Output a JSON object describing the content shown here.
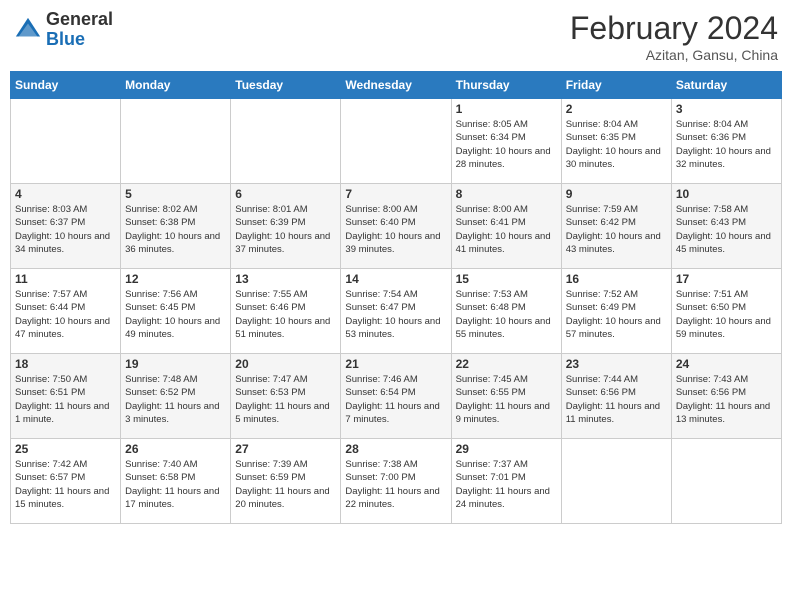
{
  "header": {
    "logo_general": "General",
    "logo_blue": "Blue",
    "month_title": "February 2024",
    "location": "Azitan, Gansu, China"
  },
  "days_of_week": [
    "Sunday",
    "Monday",
    "Tuesday",
    "Wednesday",
    "Thursday",
    "Friday",
    "Saturday"
  ],
  "weeks": [
    [
      {
        "day": "",
        "info": ""
      },
      {
        "day": "",
        "info": ""
      },
      {
        "day": "",
        "info": ""
      },
      {
        "day": "",
        "info": ""
      },
      {
        "day": "1",
        "info": "Sunrise: 8:05 AM\nSunset: 6:34 PM\nDaylight: 10 hours and 28 minutes."
      },
      {
        "day": "2",
        "info": "Sunrise: 8:04 AM\nSunset: 6:35 PM\nDaylight: 10 hours and 30 minutes."
      },
      {
        "day": "3",
        "info": "Sunrise: 8:04 AM\nSunset: 6:36 PM\nDaylight: 10 hours and 32 minutes."
      }
    ],
    [
      {
        "day": "4",
        "info": "Sunrise: 8:03 AM\nSunset: 6:37 PM\nDaylight: 10 hours and 34 minutes."
      },
      {
        "day": "5",
        "info": "Sunrise: 8:02 AM\nSunset: 6:38 PM\nDaylight: 10 hours and 36 minutes."
      },
      {
        "day": "6",
        "info": "Sunrise: 8:01 AM\nSunset: 6:39 PM\nDaylight: 10 hours and 37 minutes."
      },
      {
        "day": "7",
        "info": "Sunrise: 8:00 AM\nSunset: 6:40 PM\nDaylight: 10 hours and 39 minutes."
      },
      {
        "day": "8",
        "info": "Sunrise: 8:00 AM\nSunset: 6:41 PM\nDaylight: 10 hours and 41 minutes."
      },
      {
        "day": "9",
        "info": "Sunrise: 7:59 AM\nSunset: 6:42 PM\nDaylight: 10 hours and 43 minutes."
      },
      {
        "day": "10",
        "info": "Sunrise: 7:58 AM\nSunset: 6:43 PM\nDaylight: 10 hours and 45 minutes."
      }
    ],
    [
      {
        "day": "11",
        "info": "Sunrise: 7:57 AM\nSunset: 6:44 PM\nDaylight: 10 hours and 47 minutes."
      },
      {
        "day": "12",
        "info": "Sunrise: 7:56 AM\nSunset: 6:45 PM\nDaylight: 10 hours and 49 minutes."
      },
      {
        "day": "13",
        "info": "Sunrise: 7:55 AM\nSunset: 6:46 PM\nDaylight: 10 hours and 51 minutes."
      },
      {
        "day": "14",
        "info": "Sunrise: 7:54 AM\nSunset: 6:47 PM\nDaylight: 10 hours and 53 minutes."
      },
      {
        "day": "15",
        "info": "Sunrise: 7:53 AM\nSunset: 6:48 PM\nDaylight: 10 hours and 55 minutes."
      },
      {
        "day": "16",
        "info": "Sunrise: 7:52 AM\nSunset: 6:49 PM\nDaylight: 10 hours and 57 minutes."
      },
      {
        "day": "17",
        "info": "Sunrise: 7:51 AM\nSunset: 6:50 PM\nDaylight: 10 hours and 59 minutes."
      }
    ],
    [
      {
        "day": "18",
        "info": "Sunrise: 7:50 AM\nSunset: 6:51 PM\nDaylight: 11 hours and 1 minute."
      },
      {
        "day": "19",
        "info": "Sunrise: 7:48 AM\nSunset: 6:52 PM\nDaylight: 11 hours and 3 minutes."
      },
      {
        "day": "20",
        "info": "Sunrise: 7:47 AM\nSunset: 6:53 PM\nDaylight: 11 hours and 5 minutes."
      },
      {
        "day": "21",
        "info": "Sunrise: 7:46 AM\nSunset: 6:54 PM\nDaylight: 11 hours and 7 minutes."
      },
      {
        "day": "22",
        "info": "Sunrise: 7:45 AM\nSunset: 6:55 PM\nDaylight: 11 hours and 9 minutes."
      },
      {
        "day": "23",
        "info": "Sunrise: 7:44 AM\nSunset: 6:56 PM\nDaylight: 11 hours and 11 minutes."
      },
      {
        "day": "24",
        "info": "Sunrise: 7:43 AM\nSunset: 6:56 PM\nDaylight: 11 hours and 13 minutes."
      }
    ],
    [
      {
        "day": "25",
        "info": "Sunrise: 7:42 AM\nSunset: 6:57 PM\nDaylight: 11 hours and 15 minutes."
      },
      {
        "day": "26",
        "info": "Sunrise: 7:40 AM\nSunset: 6:58 PM\nDaylight: 11 hours and 17 minutes."
      },
      {
        "day": "27",
        "info": "Sunrise: 7:39 AM\nSunset: 6:59 PM\nDaylight: 11 hours and 20 minutes."
      },
      {
        "day": "28",
        "info": "Sunrise: 7:38 AM\nSunset: 7:00 PM\nDaylight: 11 hours and 22 minutes."
      },
      {
        "day": "29",
        "info": "Sunrise: 7:37 AM\nSunset: 7:01 PM\nDaylight: 11 hours and 24 minutes."
      },
      {
        "day": "",
        "info": ""
      },
      {
        "day": "",
        "info": ""
      }
    ]
  ]
}
